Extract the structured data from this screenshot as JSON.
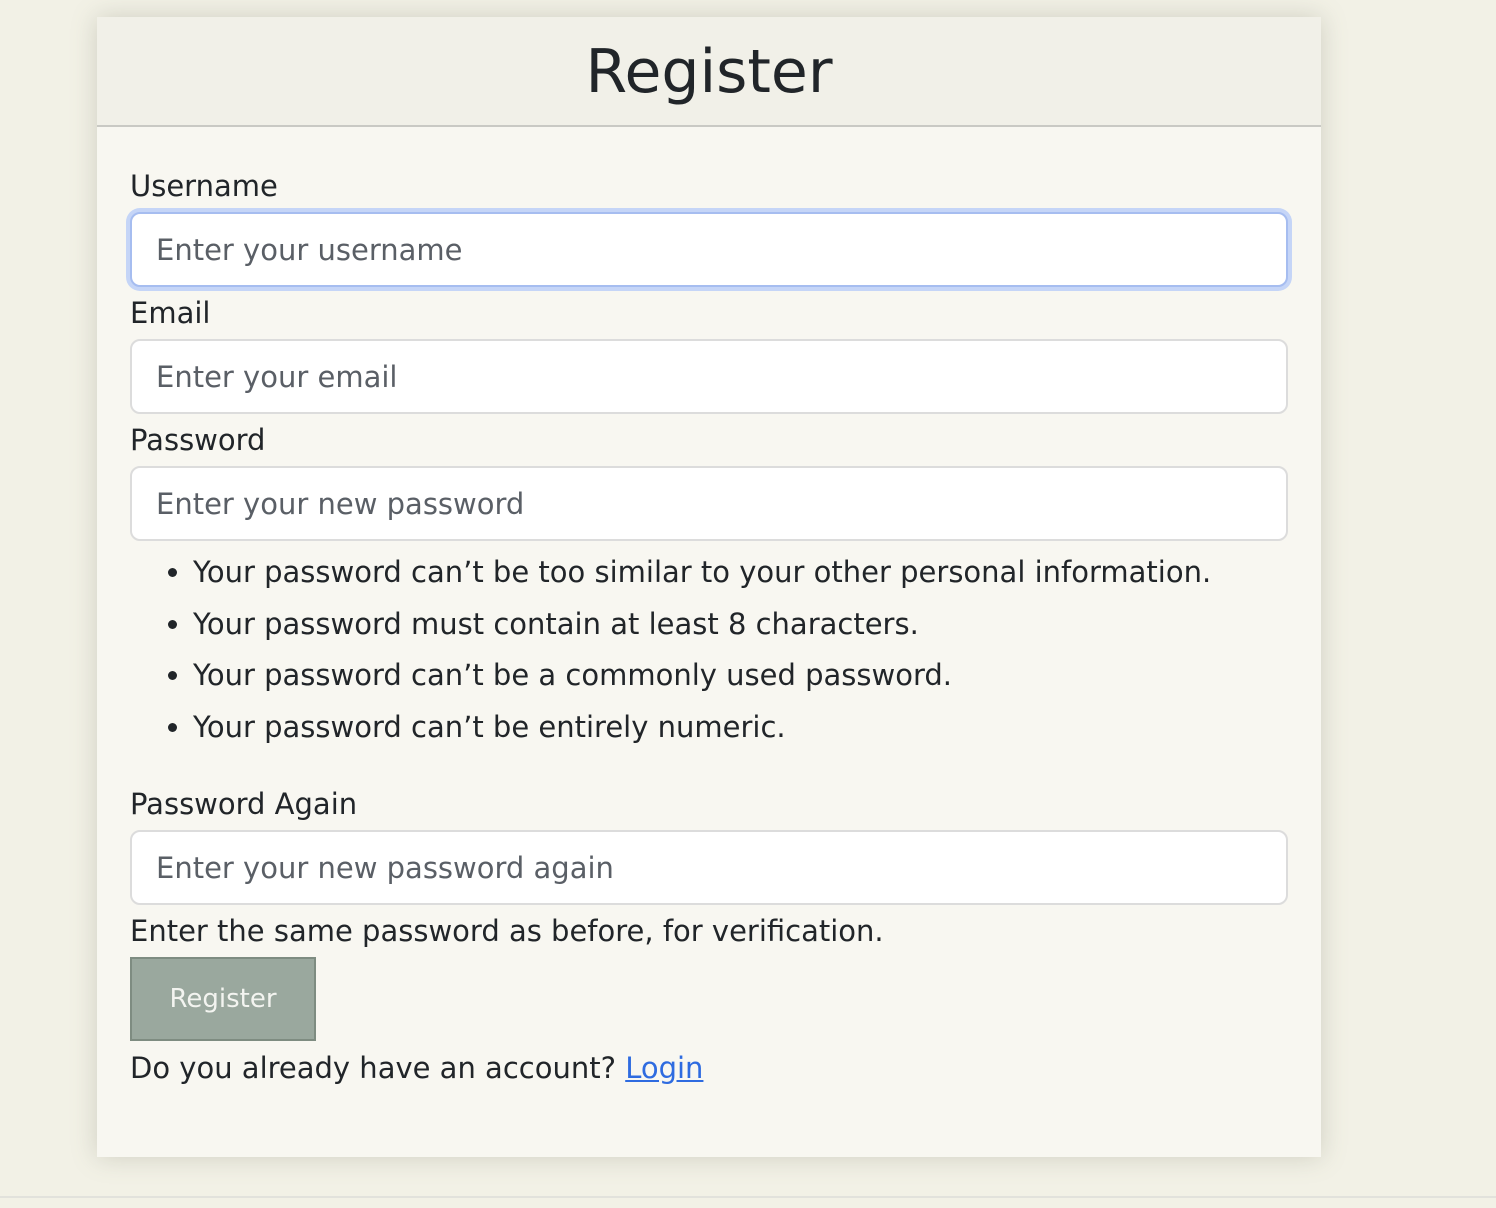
{
  "form": {
    "title": "Register",
    "username": {
      "label": "Username",
      "placeholder": "Enter your username",
      "value": ""
    },
    "email": {
      "label": "Email",
      "placeholder": "Enter your email",
      "value": ""
    },
    "password": {
      "label": "Password",
      "placeholder": "Enter your new password",
      "value": "",
      "rules": [
        "Your password can’t be too similar to your other personal information.",
        "Your password must contain at least 8 characters.",
        "Your password can’t be a commonly used password.",
        "Your password can’t be entirely numeric."
      ]
    },
    "password_again": {
      "label": "Password Again",
      "placeholder": "Enter your new password again",
      "value": "",
      "help": "Enter the same password as before, for verification."
    },
    "submit_label": "Register",
    "login_prompt": "Do you already have an account?",
    "login_link": "Login"
  },
  "colors": {
    "page_background": "#f2f1e6",
    "card_background": "#f8f7f1",
    "button_background": "#9aa89e",
    "focus_ring": "#a6bdf0",
    "link": "#2e6be0"
  }
}
